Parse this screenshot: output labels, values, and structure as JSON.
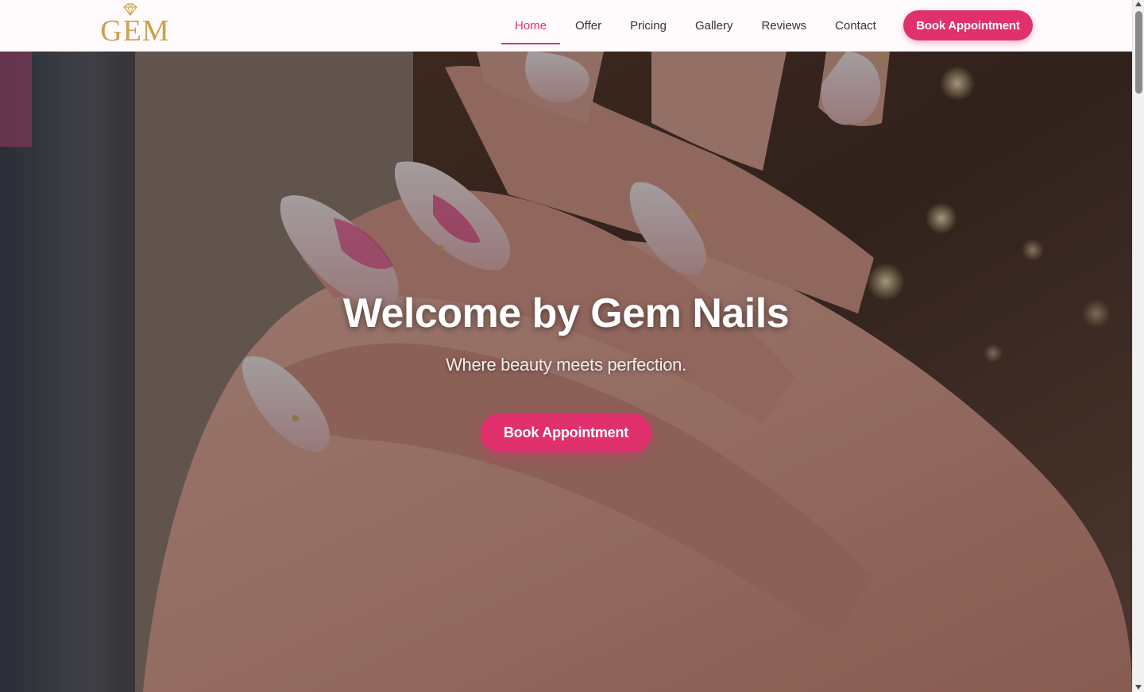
{
  "brand": {
    "logo_text": "GEM"
  },
  "nav": {
    "items": [
      {
        "label": "Home",
        "active": true
      },
      {
        "label": "Offer",
        "active": false
      },
      {
        "label": "Pricing",
        "active": false
      },
      {
        "label": "Gallery",
        "active": false
      },
      {
        "label": "Reviews",
        "active": false
      },
      {
        "label": "Contact",
        "active": false
      }
    ],
    "cta_label": "Book Appointment"
  },
  "hero": {
    "title": "Welcome by Gem Nails",
    "subtitle": "Where beauty meets perfection.",
    "cta_label": "Book Appointment"
  },
  "colors": {
    "accent": "#e0306e",
    "logo_gold": "#caa24c",
    "header_bg": "#fffafb"
  }
}
